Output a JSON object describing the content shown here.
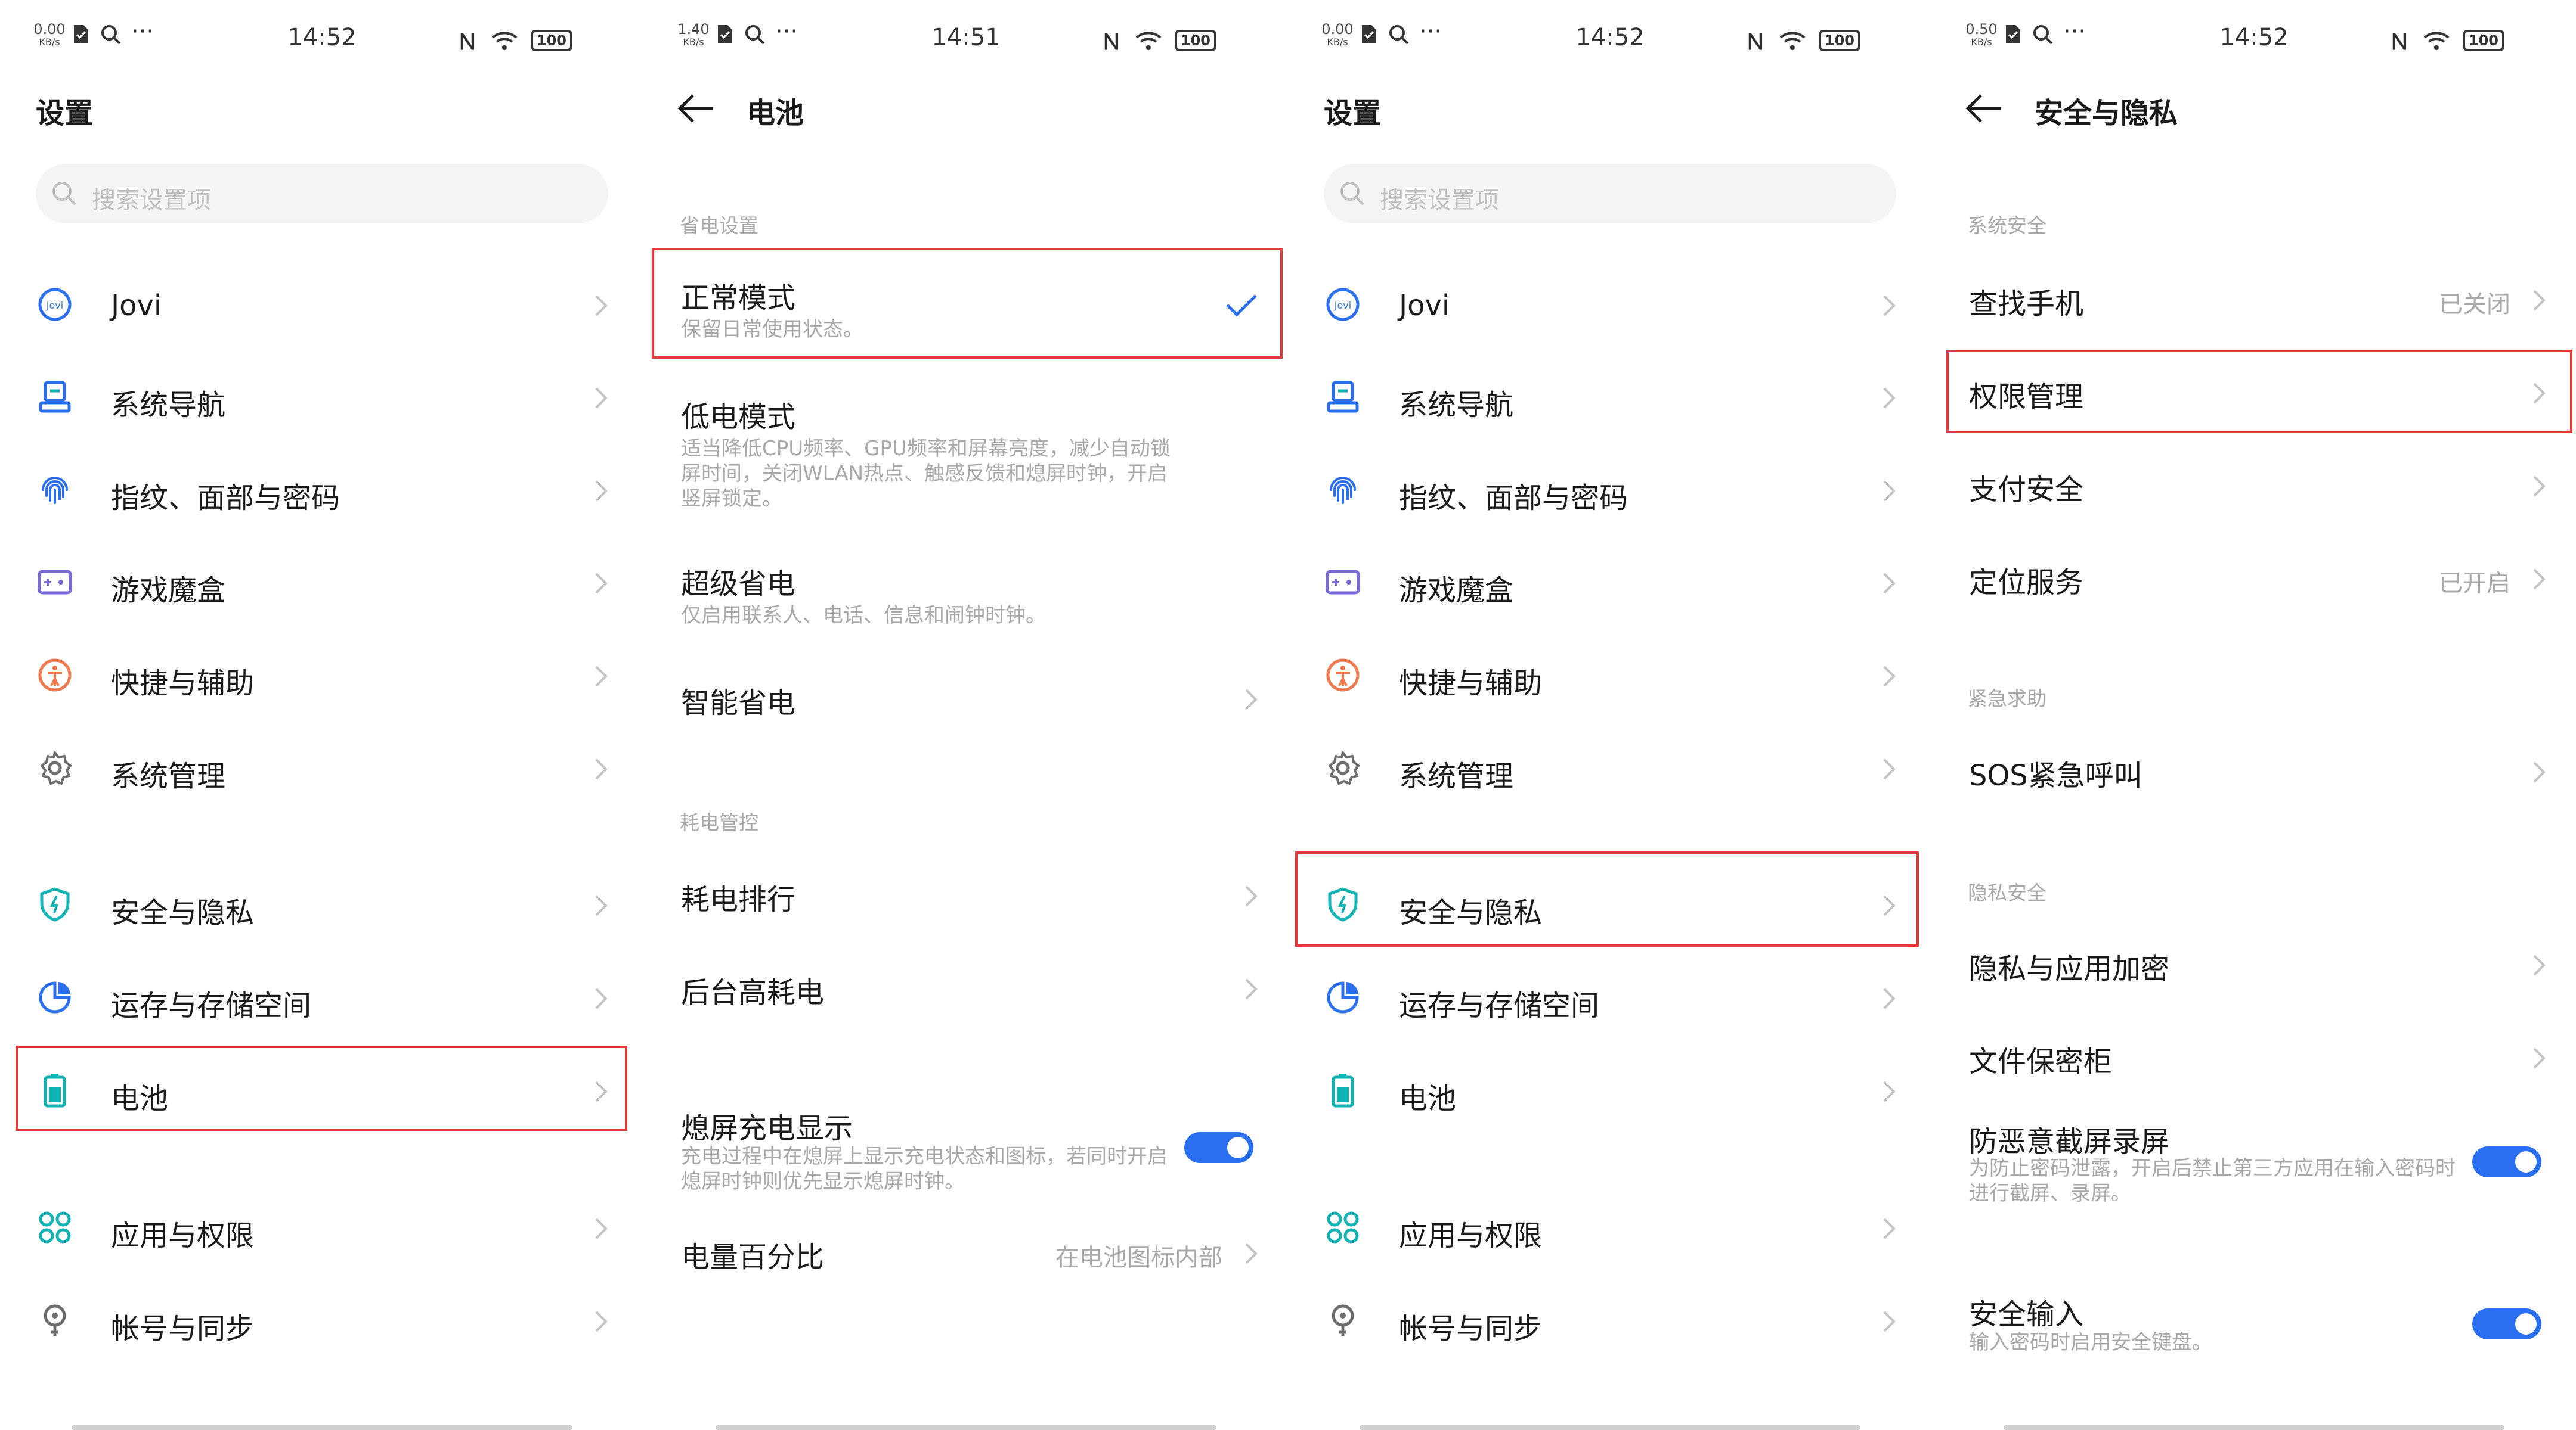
{
  "status": {
    "p0": {
      "net_speed": "0.00",
      "net_unit": "KB/s",
      "time": "14:52",
      "battery": "100"
    },
    "p1": {
      "net_speed": "1.40",
      "net_unit": "KB/s",
      "time": "14:51",
      "battery": "100"
    },
    "p2": {
      "net_speed": "0.00",
      "net_unit": "KB/s",
      "time": "14:52",
      "battery": "100"
    },
    "p3": {
      "net_speed": "0.50",
      "net_unit": "KB/s",
      "time": "14:52",
      "battery": "100"
    }
  },
  "settings": {
    "title": "设置",
    "search_placeholder": "搜索设置项",
    "items": [
      {
        "label": "Jovi",
        "icon": "jovi-icon"
      },
      {
        "label": "系统导航",
        "icon": "system-navigation-icon"
      },
      {
        "label": "指纹、面部与密码",
        "icon": "fingerprint-icon"
      },
      {
        "label": "游戏魔盒",
        "icon": "game-box-icon"
      },
      {
        "label": "快捷与辅助",
        "icon": "accessibility-icon"
      },
      {
        "label": "系统管理",
        "icon": "gear-icon"
      },
      {
        "label": "安全与隐私",
        "icon": "shield-icon"
      },
      {
        "label": "运存与存储空间",
        "icon": "storage-pie-icon"
      },
      {
        "label": "电池",
        "icon": "battery-icon"
      },
      {
        "label": "应用与权限",
        "icon": "apps-icon"
      },
      {
        "label": "帐号与同步",
        "icon": "account-icon"
      }
    ]
  },
  "battery_page": {
    "title": "电池",
    "section_power_saving": "省电设置",
    "normal_mode": {
      "title": "正常模式",
      "subtitle": "保留日常使用状态。"
    },
    "low_power_mode": {
      "title": "低电模式",
      "subtitle": "适当降低CPU频率、GPU频率和屏幕亮度，减少自动锁屏时间，关闭WLAN热点、触感反馈和熄屏时钟，开启竖屏锁定。"
    },
    "super_saver": {
      "title": "超级省电",
      "subtitle": "仅启用联系人、电话、信息和闹钟时钟。"
    },
    "smart_saver": {
      "title": "智能省电"
    },
    "section_consumption": "耗电管控",
    "usage_ranking": {
      "title": "耗电排行"
    },
    "background_usage": {
      "title": "后台高耗电"
    },
    "aod_charging": {
      "title": "熄屏充电显示",
      "subtitle": "充电过程中在熄屏上显示充电状态和图标，若同时开启熄屏时钟则优先显示熄屏时钟。"
    },
    "battery_percent": {
      "title": "电量百分比",
      "value": "在电池图标内部"
    }
  },
  "security_page": {
    "title": "安全与隐私",
    "section_system": "系统安全",
    "find_phone": {
      "title": "查找手机",
      "value": "已关闭"
    },
    "permission_mgmt": {
      "title": "权限管理"
    },
    "payment_security": {
      "title": "支付安全"
    },
    "location": {
      "title": "定位服务",
      "value": "已开启"
    },
    "section_emergency": "紧急求助",
    "sos": {
      "title": "SOS紧急呼叫"
    },
    "section_privacy": "隐私安全",
    "privacy_encrypt": {
      "title": "隐私与应用加密"
    },
    "file_safe": {
      "title": "文件保密柜"
    },
    "anti_screenshot": {
      "title": "防恶意截屏录屏",
      "subtitle": "为防止密码泄露，开启后禁止第三方应用在输入密码时进行截屏、录屏。"
    },
    "secure_input": {
      "title": "安全输入",
      "subtitle": "输入密码时启用安全键盘。"
    }
  },
  "colors": {
    "accent": "#2a6ff0",
    "highlight": "#e23a3a",
    "teal": "#12b3b5",
    "secondary_text": "#a8a8a8"
  }
}
